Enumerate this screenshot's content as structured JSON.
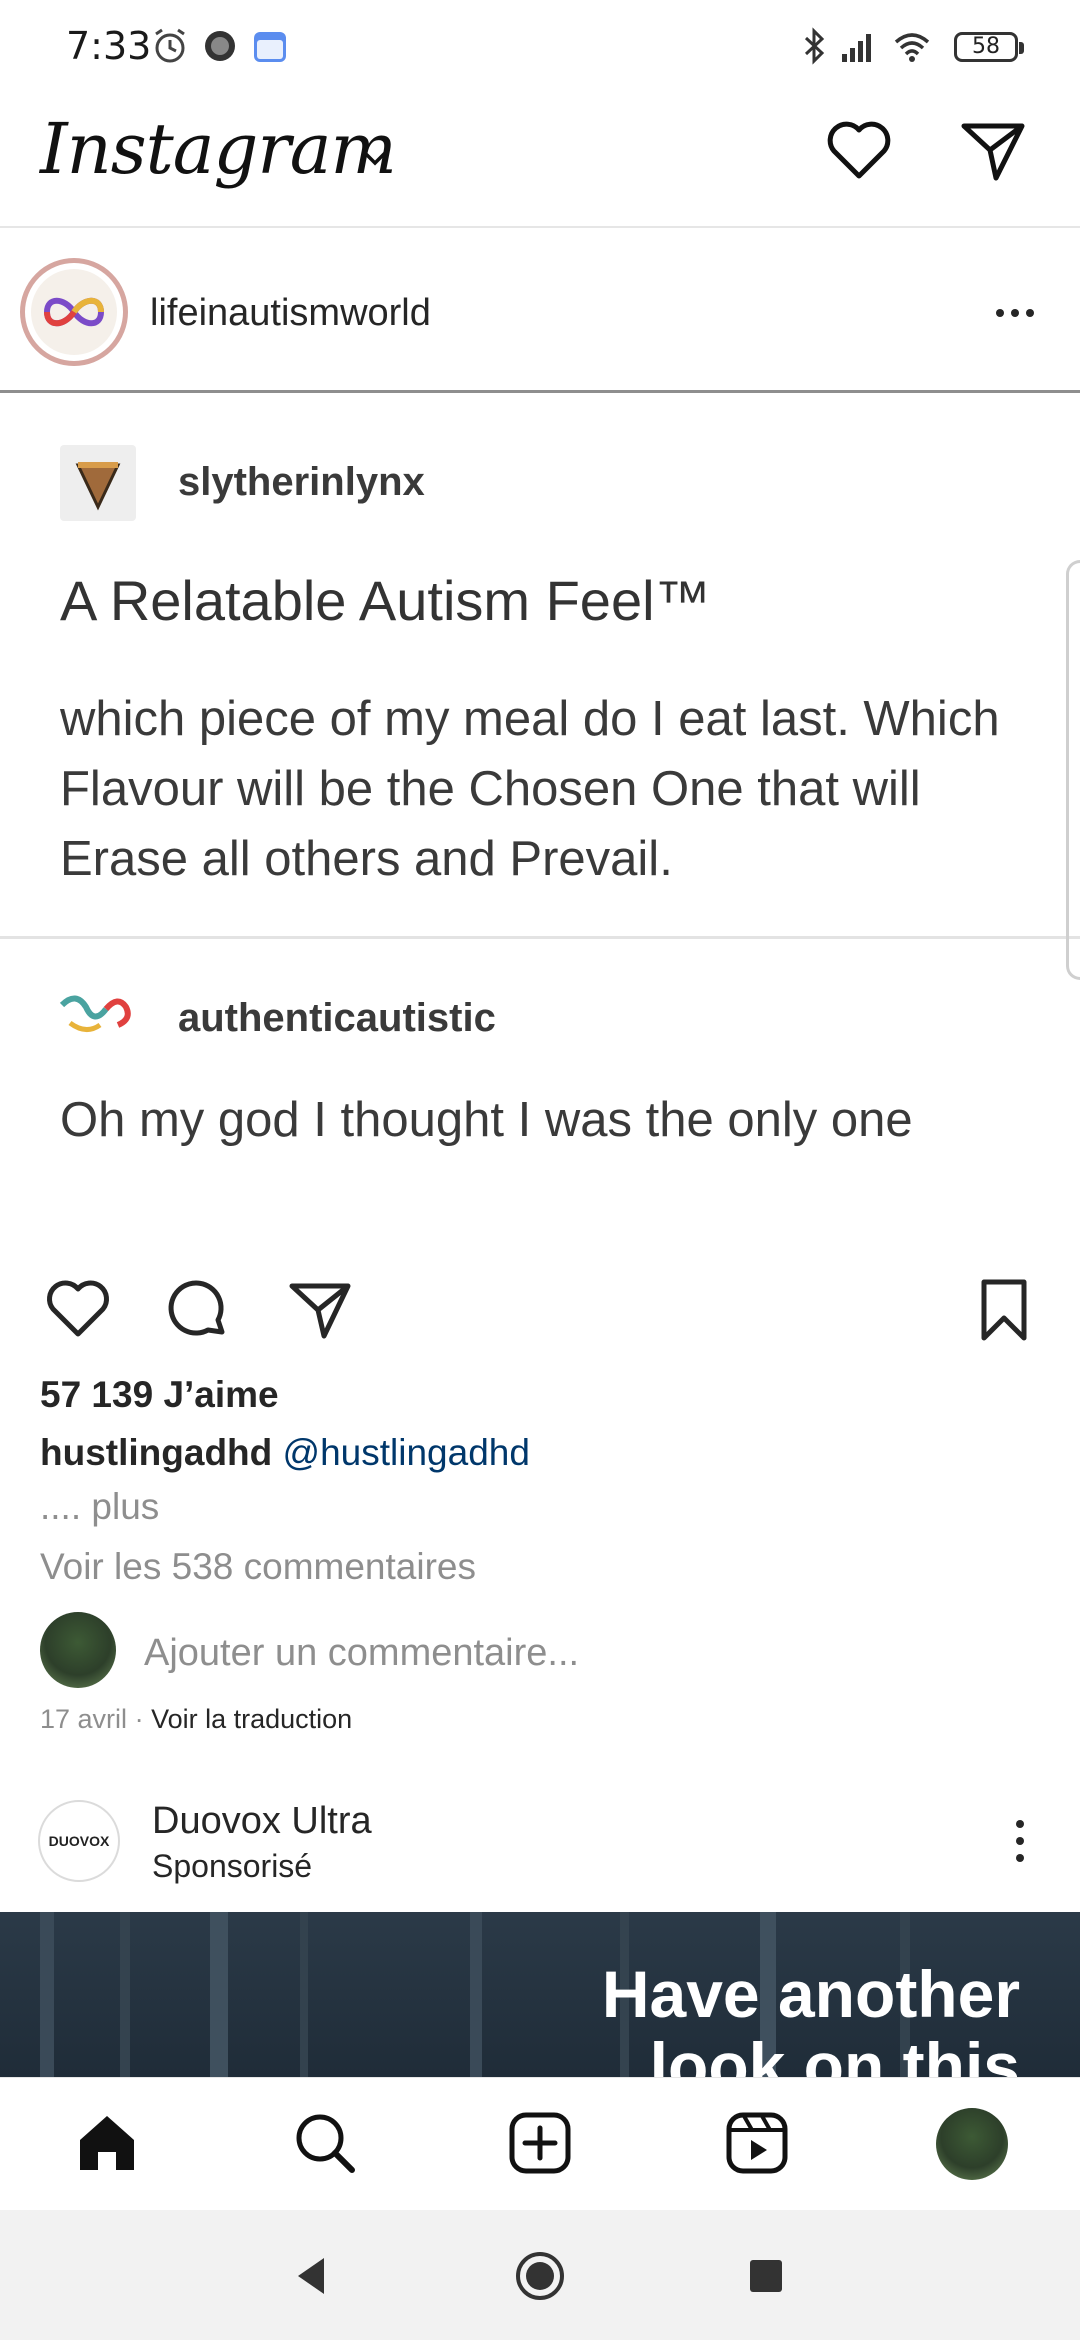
{
  "status_bar": {
    "time": "7:33",
    "battery": "58"
  },
  "header": {
    "logo": "Instagram"
  },
  "post": {
    "username": "lifeinautismworld",
    "image": {
      "op_username": "slytherinlynx",
      "title": "A Relatable Autism Feel™",
      "body_lines": [
        "which piece of my meal do I eat last. Which",
        "Flavour will be the Chosen One that will",
        "Erase all others and Prevail."
      ],
      "reply_username": "authenticautistic",
      "reply_text": "Oh my god I thought I was the only one"
    },
    "likes": "57 139 J’aime",
    "caption_user": "hustlingadhd",
    "caption_mention": "@hustlingadhd",
    "more": ".... plus",
    "view_comments": "Voir les 538 commentaires",
    "add_comment_placeholder": "Ajouter un commentaire...",
    "date": "17 avril",
    "date_separator": "·",
    "translate": "Voir la traduction"
  },
  "sponsored": {
    "avatar_text": "DUOVOX",
    "name": "Duovox Ultra",
    "label": "Sponsorisé",
    "ad_text_line1": "Have another",
    "ad_text_line2": "look on this"
  },
  "colors": {
    "text": "#262626",
    "muted": "#8e8e8e",
    "link": "#00376b"
  }
}
